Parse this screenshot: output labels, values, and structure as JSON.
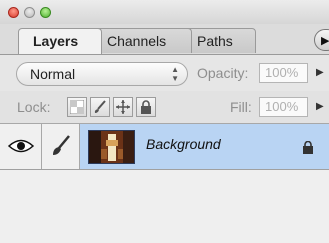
{
  "window": {
    "controls": [
      "close",
      "minimize",
      "zoom"
    ]
  },
  "tabs": [
    {
      "label": "Layers",
      "active": true
    },
    {
      "label": "Channels",
      "active": false
    },
    {
      "label": "Paths",
      "active": false
    }
  ],
  "blend": {
    "mode": "Normal",
    "opacity_label": "Opacity:",
    "opacity_value": "100%"
  },
  "lock": {
    "label": "Lock:",
    "icons": [
      "transparency-lock-icon",
      "brush-lock-icon",
      "move-lock-icon",
      "padlock-icon"
    ],
    "fill_label": "Fill:",
    "fill_value": "100%"
  },
  "layers": [
    {
      "name": "Background",
      "visible": true,
      "locked": true
    }
  ],
  "colors": {
    "selection": "#b9d4f3"
  }
}
